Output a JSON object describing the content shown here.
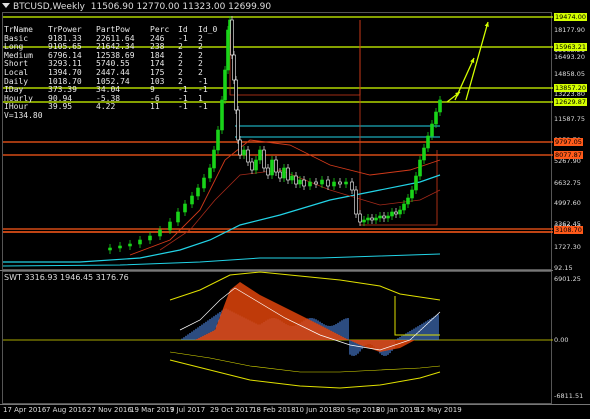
{
  "header": {
    "symbol": "BTCUSD,Weekly",
    "ohlc": "11506.90 12770.00 11323.00 12699.90"
  },
  "stats": {
    "columns": [
      "TrName",
      "TrPower",
      "PartPow",
      "Perc",
      "Id",
      "Id_0"
    ],
    "rows": [
      [
        "Basic",
        "9181.33",
        "22611.64",
        "246",
        "-1",
        "2"
      ],
      [
        "Long",
        "9105.65",
        "21642.34",
        "238",
        "2",
        "2"
      ],
      [
        "Medium",
        "6796.14",
        "12538.69",
        "184",
        "2",
        "2"
      ],
      [
        "Short",
        "3293.11",
        "5740.55",
        "174",
        "2",
        "2"
      ],
      [
        "Local",
        "1394.70",
        "2447.44",
        "175",
        "2",
        "2"
      ],
      [
        "Daily",
        "1018.70",
        "1052.74",
        "103",
        "2",
        "-1"
      ],
      [
        "IDay",
        "373.39",
        "34.04",
        "9",
        "-1",
        "-1"
      ],
      [
        "Hourly",
        "90.94",
        "-5.38",
        "-6",
        "-1",
        "1"
      ],
      [
        "IHour",
        "39.95",
        "4.22",
        "11",
        "-1",
        "-1"
      ]
    ],
    "footer": "V=134.80"
  },
  "price_axis": {
    "labels": [
      "19474.00",
      "18177.90",
      "15963.21",
      "16493.20",
      "14858.05",
      "13857.20",
      "13223.80",
      "12629.87",
      "11587.75",
      "9952.70",
      "9797.05",
      "8627.35",
      "8077.87",
      "5267.90",
      "6632.75",
      "4997.60",
      "3362.45",
      "3108.70",
      "1727.30",
      "92.15"
    ]
  },
  "level_tags": [
    {
      "text": "19474.00",
      "color": "#d4ff00"
    },
    {
      "text": "15963.21",
      "color": "#d4ff00"
    },
    {
      "text": "13857.20",
      "color": "#d4ff00"
    },
    {
      "text": "12629.87",
      "color": "#d4ff00"
    },
    {
      "text": "9797.05",
      "color": "#ff5a1a"
    },
    {
      "text": "8077.87",
      "color": "#ff5a1a"
    },
    {
      "text": "3108.70",
      "color": "#ff5a1a"
    }
  ],
  "indicator": {
    "label": "SWT 3316.93 1946.45 3176.76",
    "axis_labels": [
      "6901.25",
      "0.00",
      "-6811.51"
    ]
  },
  "time_axis": {
    "labels": [
      "17 Apr 2016",
      "7 Aug 2016",
      "27 Nov 2016",
      "19 Mar 2017",
      "9 Jul 2017",
      "29 Oct 2017",
      "18 Feb 2018",
      "10 Jun 2018",
      "30 Sep 2018",
      "20 Jan 2019",
      "12 May 2019"
    ]
  },
  "colors": {
    "background": "#000000",
    "candle_up": "#19d419",
    "candle_down": "#ffffff",
    "resistance": "#d4ff00",
    "support": "#ff5a1a",
    "ma_cyan": "#22d3e6",
    "ma_red": "#d23a1a",
    "hist_blue": "#4a7fd4",
    "hist_orange": "#e0440a",
    "band_yellow": "#e0e000"
  },
  "icons": {
    "dropdown": "dropdown-triangle-icon"
  }
}
